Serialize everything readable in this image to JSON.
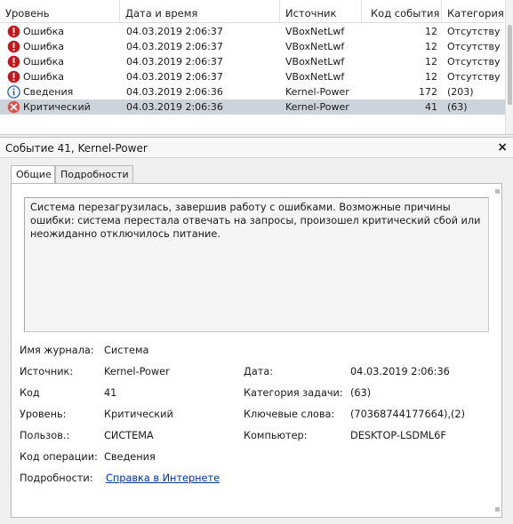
{
  "columns": {
    "level": "Уровень",
    "datetime": "Дата и время",
    "source": "Источник",
    "event_id": "Код события",
    "category": "Категория"
  },
  "rows": [
    {
      "icon": "error-icon",
      "level": "Ошибка",
      "datetime": "04.03.2019 2:06:37",
      "source": "VBoxNetLwf",
      "event_id": "12",
      "category": "Отсутству"
    },
    {
      "icon": "error-icon",
      "level": "Ошибка",
      "datetime": "04.03.2019 2:06:37",
      "source": "VBoxNetLwf",
      "event_id": "12",
      "category": "Отсутству"
    },
    {
      "icon": "error-icon",
      "level": "Ошибка",
      "datetime": "04.03.2019 2:06:37",
      "source": "VBoxNetLwf",
      "event_id": "12",
      "category": "Отсутству"
    },
    {
      "icon": "error-icon",
      "level": "Ошибка",
      "datetime": "04.03.2019 2:06:37",
      "source": "VBoxNetLwf",
      "event_id": "12",
      "category": "Отсутству"
    },
    {
      "icon": "info-icon",
      "level": "Сведения",
      "datetime": "04.03.2019 2:06:36",
      "source": "Kernel-Power",
      "event_id": "172",
      "category": "(203)"
    },
    {
      "icon": "critical-icon",
      "level": "Критический",
      "datetime": "04.03.2019 2:06:36",
      "source": "Kernel-Power",
      "event_id": "41",
      "category": "(63)",
      "selected": true
    }
  ],
  "detail": {
    "title": "Событие 41, Kernel-Power",
    "close_symbol": "×",
    "tabs": {
      "general": "Общие",
      "details": "Подробности"
    },
    "description": "Система перезагрузилась, завершив работу с ошибками. Возможные причины ошибки: система перестала отвечать на запросы, произошел критический сбой или неожиданно отключилось питание.",
    "fields": {
      "log_name_label": "Имя журнала:",
      "log_name": "Система",
      "source_label": "Источник:",
      "source": "Kernel-Power",
      "date_label": "Дата:",
      "date": "04.03.2019 2:06:36",
      "code_label": "Код",
      "code": "41",
      "task_category_label": "Категория задачи:",
      "task_category": "(63)",
      "level_label": "Уровень:",
      "level": "Критический",
      "keywords_label": "Ключевые слова:",
      "keywords": "(70368744177664),(2)",
      "user_label": "Пользов.:",
      "user": "СИСТЕМА",
      "computer_label": "Компьютер:",
      "computer": "DESKTOP-LSDML6F",
      "opcode_label": "Код операции:",
      "opcode": "Сведения",
      "more_label": "Подробности:",
      "more_link": "Справка в Интернете"
    }
  },
  "colors": {
    "selected_row": "#cdd3da",
    "error": "#c4161c",
    "info": "#1f5fb5",
    "critical": "#d9534f",
    "link": "#0033aa"
  }
}
